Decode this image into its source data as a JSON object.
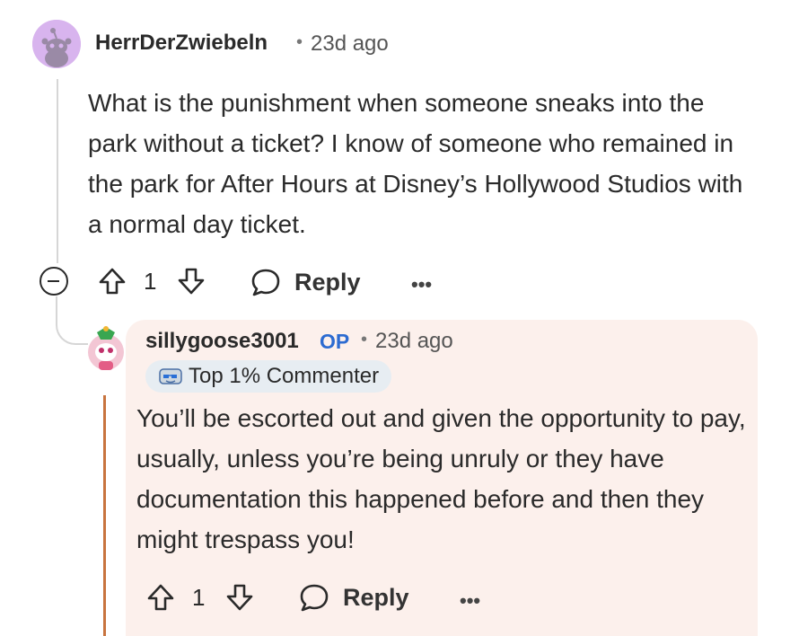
{
  "comment": {
    "author": "HerrDerZwiebeln",
    "separator": "•",
    "time": "23d ago",
    "body": "What is the punishment when someone sneaks into the park without a ticket? I know of someone who remained in the park for After Hours at Disney’s Hollywood Studios with a normal day ticket.",
    "votes": "1",
    "reply_label": "Reply",
    "more_label": "•••",
    "avatar_icon": "reddit-snoo-avatar-icon",
    "colors": {
      "avatar_bg": "#d8b4ee"
    }
  },
  "reply": {
    "author": "sillygoose3001",
    "op_label": "OP",
    "separator": "•",
    "time": "23d ago",
    "badge": "Top 1% Commenter",
    "badge_icon": "commenter-badge-icon",
    "body": "You’ll be escorted out and given the opportunity to pay, usually, unless you’re being unruly or they have documentation this happened before and then they might trespass you!",
    "votes": "1",
    "reply_label": "Reply",
    "more_label": "•••",
    "colors": {
      "card_bg": "#fcf0ec",
      "op": "#2c6bd1",
      "thread_line": "#c8743f"
    }
  }
}
